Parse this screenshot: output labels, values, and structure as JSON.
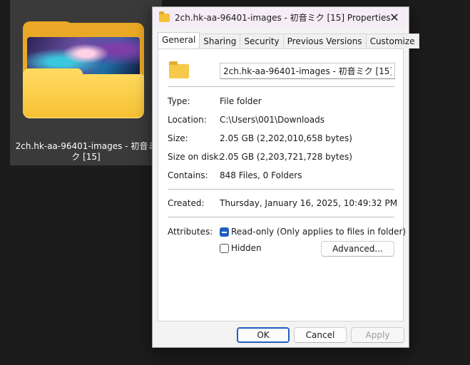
{
  "desktop": {
    "folder_name": "2ch.hk-aa-96401-images - 初音ミク [15]"
  },
  "dialog": {
    "title": "2ch.hk-aa-96401-images - 初音ミク [15] Properties",
    "close_glyph": "✕",
    "tabs": [
      {
        "label": "General",
        "active": true
      },
      {
        "label": "Sharing"
      },
      {
        "label": "Security"
      },
      {
        "label": "Previous Versions"
      },
      {
        "label": "Customize"
      }
    ],
    "name_value": "2ch.hk-aa-96401-images - 初音ミク [15]",
    "properties": {
      "type_label": "Type:",
      "type_value": "File folder",
      "location_label": "Location:",
      "location_value": "C:\\Users\\001\\Downloads",
      "size_label": "Size:",
      "size_value": "2.05 GB (2,202,010,658 bytes)",
      "size_on_disk_label": "Size on disk:",
      "size_on_disk_value": "2.05 GB (2,203,721,728 bytes)",
      "contains_label": "Contains:",
      "contains_value": "848 Files, 0 Folders",
      "created_label": "Created:",
      "created_value": "Thursday, January 16, 2025, 10:49:32 PM"
    },
    "attributes": {
      "label": "Attributes:",
      "readonly_label": "Read-only (Only applies to files in folder)",
      "readonly_state": "indeterminate",
      "hidden_label": "Hidden",
      "hidden_state": "unchecked",
      "advanced_label": "Advanced..."
    },
    "buttons": {
      "ok": "OK",
      "cancel": "Cancel",
      "apply": "Apply"
    }
  },
  "colors": {
    "accent": "#1f5fbf",
    "folder_yellow": "#f6c94a",
    "desktop_bg": "#1c1c1c"
  }
}
